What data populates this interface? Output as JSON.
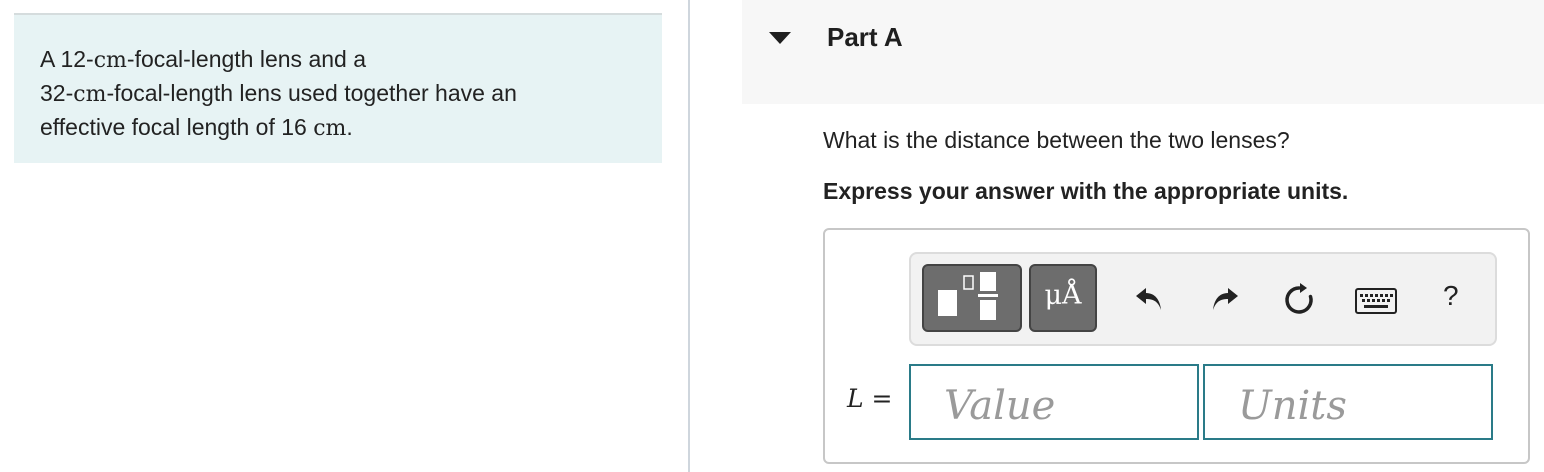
{
  "problem": {
    "p1": "A 12-",
    "u1": "cm",
    "p2": "-focal-length lens and a",
    "p3": "32-",
    "u2": "cm",
    "p4": "-focal-length lens used together have an",
    "p5": "effective focal length of 16 ",
    "u3": "cm",
    "p6": "."
  },
  "part": {
    "title": "Part A"
  },
  "question": {
    "text": "What is the distance between the two lenses?",
    "instruction": "Express your answer with the appropriate units."
  },
  "toolbar": {
    "units_label": "μÅ",
    "help_label": "?",
    "icons": [
      "templates-icon",
      "undo-icon",
      "redo-icon",
      "reset-icon",
      "keyboard-icon"
    ]
  },
  "answer": {
    "variable": "L",
    "equals": " =",
    "value_placeholder": "Value",
    "units_placeholder": "Units"
  },
  "colors": {
    "problem_bg": "#e7f3f4",
    "field_border": "#2a7b88",
    "button_bg": "#6d6d6d"
  }
}
